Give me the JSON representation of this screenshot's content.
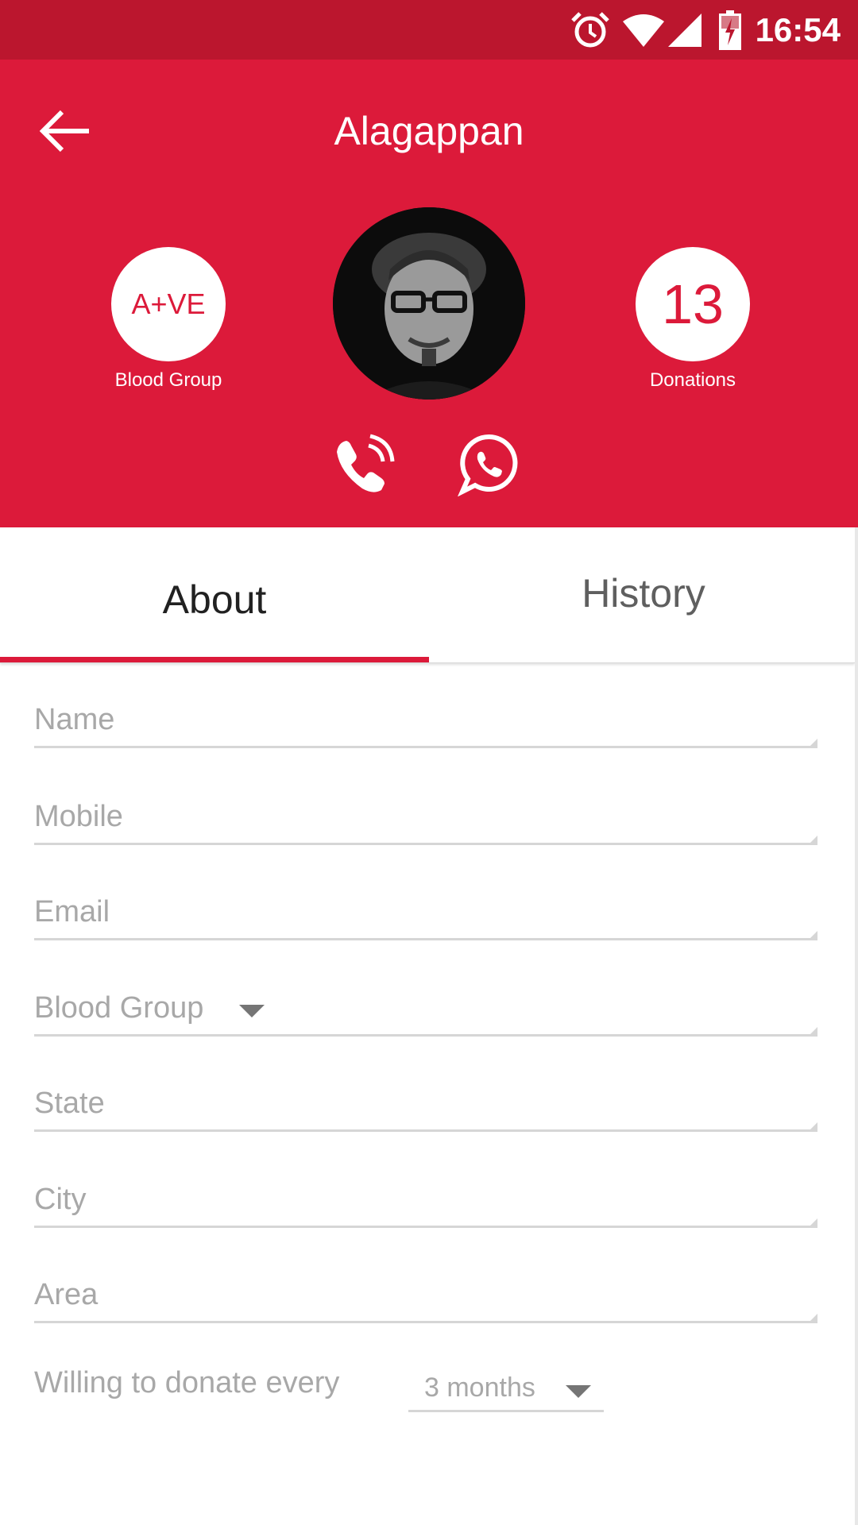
{
  "status_bar": {
    "time": "16:54",
    "icons": [
      "alarm-icon",
      "wifi-icon",
      "signal-icon",
      "battery-charging-icon"
    ]
  },
  "header": {
    "title": "Alagappan",
    "back_icon": "arrow-left-icon",
    "blood_group": {
      "value": "A+VE",
      "label": "Blood Group"
    },
    "donations": {
      "value": "13",
      "label": "Donations"
    },
    "actions": [
      "phone-call-icon",
      "whatsapp-icon"
    ]
  },
  "tabs": [
    {
      "label": "About",
      "selected": true
    },
    {
      "label": "History",
      "selected": false
    }
  ],
  "form": {
    "fields": [
      {
        "label": "Name"
      },
      {
        "label": "Mobile"
      },
      {
        "label": "Email"
      },
      {
        "label": "Blood Group",
        "type": "dropdown"
      },
      {
        "label": "State"
      },
      {
        "label": "City"
      },
      {
        "label": "Area"
      }
    ],
    "donate_label": "Willing to donate every",
    "donate_interval": "3 months"
  },
  "colors": {
    "primary": "#dc1a3a",
    "status_bar": "#bb162e",
    "hint": "#a8a8a8"
  }
}
